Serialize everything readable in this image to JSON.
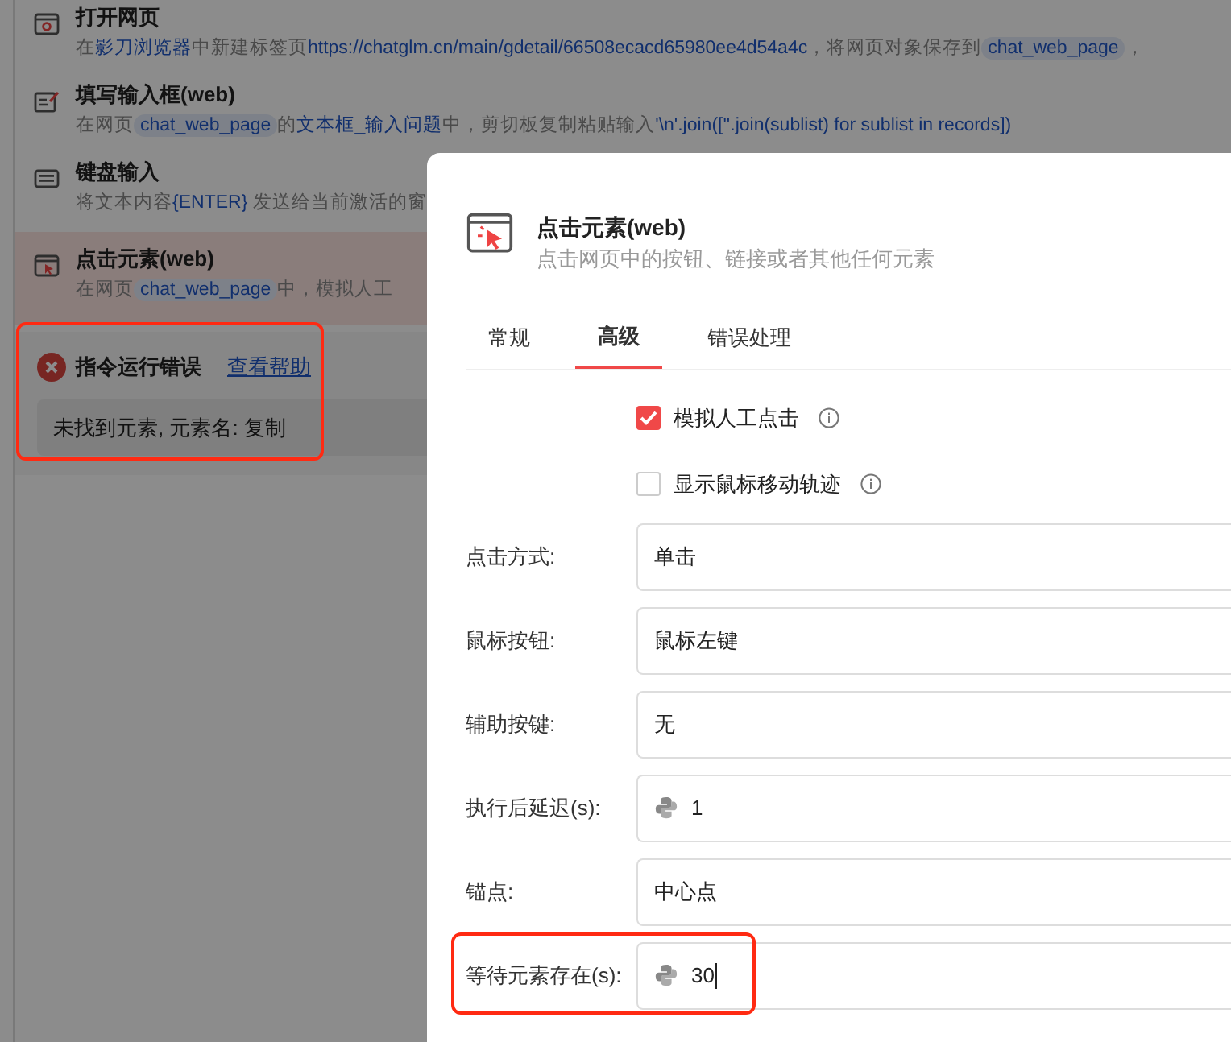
{
  "steps": [
    {
      "kind": "open-page",
      "title": "打开网页",
      "highlighted": false,
      "description": [
        {
          "kind": "text",
          "text": "在"
        },
        {
          "kind": "link",
          "text": "影刀浏览器"
        },
        {
          "kind": "text",
          "text": "中新建标签页"
        },
        {
          "kind": "link",
          "text": "https://chatglm.cn/main/gdetail/66508ecacd65980ee4d54a4c"
        },
        {
          "kind": "text",
          "text": "，将网页对象保存到"
        },
        {
          "kind": "chip",
          "text": "chat_web_page"
        },
        {
          "kind": "text",
          "text": "，"
        }
      ]
    },
    {
      "kind": "fill-input",
      "title": "填写输入框(web)",
      "highlighted": false,
      "description": [
        {
          "kind": "text",
          "text": "在网页"
        },
        {
          "kind": "chip",
          "text": "chat_web_page"
        },
        {
          "kind": "text",
          "text": "的"
        },
        {
          "kind": "link",
          "text": "文本框_输入问题"
        },
        {
          "kind": "text",
          "text": "中，剪切板复制粘贴输入"
        },
        {
          "kind": "link",
          "text": "'\\n'.join([''.join(sublist) for sublist in records])"
        }
      ]
    },
    {
      "kind": "keyboard",
      "title": "键盘输入",
      "highlighted": false,
      "description": [
        {
          "kind": "text",
          "text": "将文本内容"
        },
        {
          "kind": "link",
          "text": "{ENTER}"
        },
        {
          "kind": "text",
          "text": " 发送给当前激活的窗"
        }
      ]
    },
    {
      "kind": "click",
      "title": "点击元素(web)",
      "highlighted": true,
      "description": [
        {
          "kind": "text",
          "text": "在网页"
        },
        {
          "kind": "chip",
          "text": "chat_web_page"
        },
        {
          "kind": "text",
          "text": "中，模拟人工"
        }
      ]
    }
  ],
  "error": {
    "title": "指令运行错误",
    "help_link": "查看帮助",
    "message": "未找到元素, 元素名: 复制",
    "highlighted": true
  },
  "dialog": {
    "title": "点击元素(web)",
    "subtitle": "点击网页中的按钮、链接或者其他任何元素",
    "tabs": [
      {
        "label": "常规",
        "selected": false
      },
      {
        "label": "高级",
        "selected": true
      },
      {
        "label": "错误处理",
        "selected": false
      }
    ],
    "options": [
      {
        "label": "模拟人工点击",
        "checked": true
      },
      {
        "label": "显示鼠标移动轨迹",
        "checked": false
      }
    ],
    "fields": [
      {
        "label": "点击方式:",
        "value": "单击",
        "python": false,
        "focused": false,
        "highlighted": false
      },
      {
        "label": "鼠标按钮:",
        "value": "鼠标左键",
        "python": false,
        "focused": false,
        "highlighted": false
      },
      {
        "label": "辅助按键:",
        "value": "无",
        "python": false,
        "focused": false,
        "highlighted": false
      },
      {
        "label": "执行后延迟(s):",
        "value": "1",
        "python": true,
        "focused": false,
        "highlighted": false
      },
      {
        "label": "锚点:",
        "value": "中心点",
        "python": false,
        "focused": false,
        "highlighted": false
      },
      {
        "label": "等待元素存在(s):",
        "value": "30",
        "python": true,
        "focused": true,
        "highlighted": true
      }
    ]
  }
}
